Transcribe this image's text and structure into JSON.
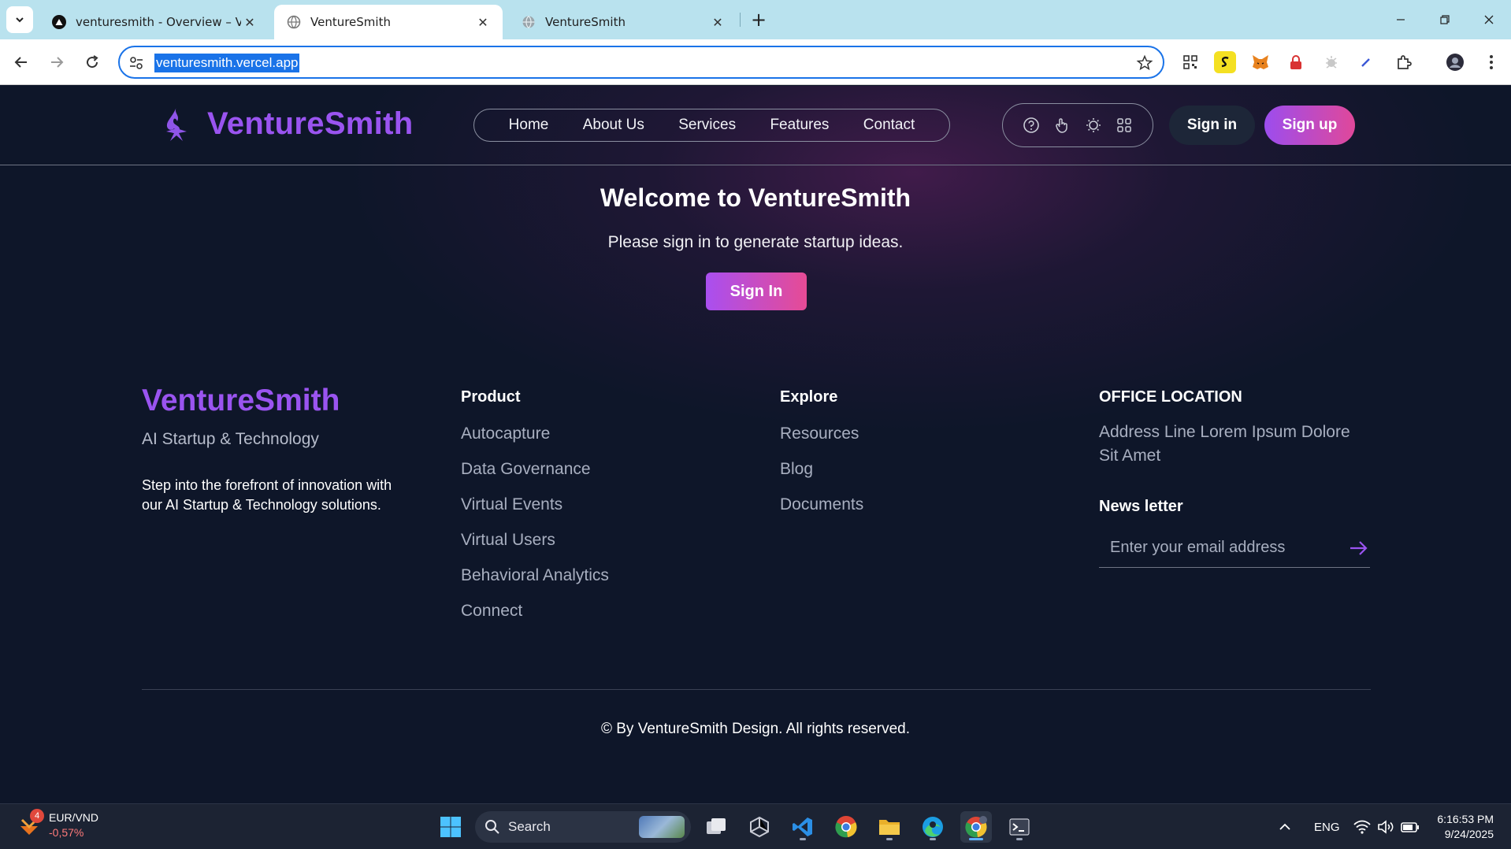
{
  "browser": {
    "tabs": [
      {
        "title": "venturesmith - Overview – Vercel",
        "active": false,
        "favicon": "vercel-triangle-icon"
      },
      {
        "title": "VentureSmith",
        "active": true,
        "favicon": "globe-icon"
      },
      {
        "title": "VentureSmith",
        "active": false,
        "favicon": "globe-icon"
      }
    ],
    "url": "venturesmith.vercel.app",
    "accent": "#1a73e8"
  },
  "site": {
    "brand": "VentureSmith",
    "brand_color": "#9a54f0",
    "nav": [
      "Home",
      "About Us",
      "Services",
      "Features",
      "Contact"
    ],
    "icons": [
      "help-circle-icon",
      "hand-pointer-icon",
      "theme-sun-icon",
      "apps-grid-icon"
    ],
    "signin_label": "Sign in",
    "signup_label": "Sign up"
  },
  "hero": {
    "title": "Welcome to VentureSmith",
    "subtitle": "Please sign in to generate startup ideas.",
    "button": "Sign In"
  },
  "footer": {
    "brand": "VentureSmith",
    "tagline": "AI Startup & Technology",
    "description": "Step into the forefront of innovation with our AI Startup & Technology solutions.",
    "product": {
      "heading": "Product",
      "links": [
        "Autocapture",
        "Data Governance",
        "Virtual Events",
        "Virtual Users",
        "Behavioral Analytics",
        "Connect"
      ]
    },
    "explore": {
      "heading": "Explore",
      "links": [
        "Resources",
        "Blog",
        "Documents"
      ]
    },
    "office": {
      "heading": "OFFICE LOCATION",
      "address": "Address Line Lorem Ipsum Dolore Sit Amet"
    },
    "newsletter": {
      "heading": "News letter",
      "placeholder": "Enter your email address"
    },
    "copyright": "© By VentureSmith Design. All rights reserved."
  },
  "taskbar": {
    "widget": {
      "badge": "4",
      "pair": "EUR/VND",
      "change": "-0,57%"
    },
    "search_label": "Search",
    "language": "ENG",
    "time": "6:16:53 PM",
    "date": "9/24/2025"
  }
}
